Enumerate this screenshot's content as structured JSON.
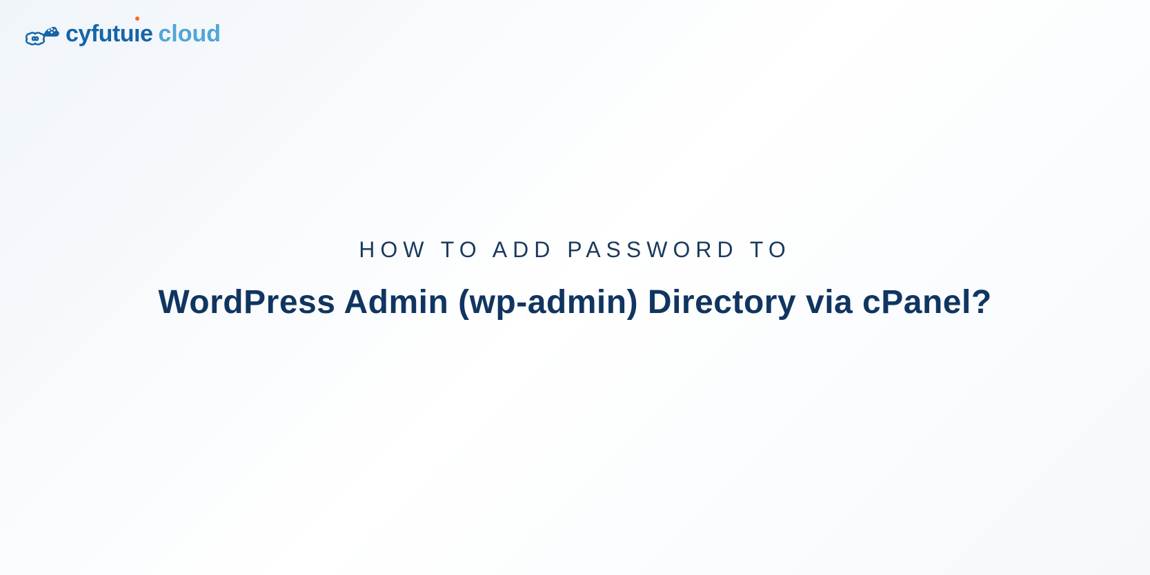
{
  "logo": {
    "brand_primary": "cyfutu",
    "brand_accent_char": "i",
    "brand_suffix": "e",
    "brand_secondary": "cloud"
  },
  "content": {
    "subtitle": "HOW TO ADD PASSWORD TO",
    "title": "WordPress Admin (wp-admin) Directory via cPanel?"
  }
}
